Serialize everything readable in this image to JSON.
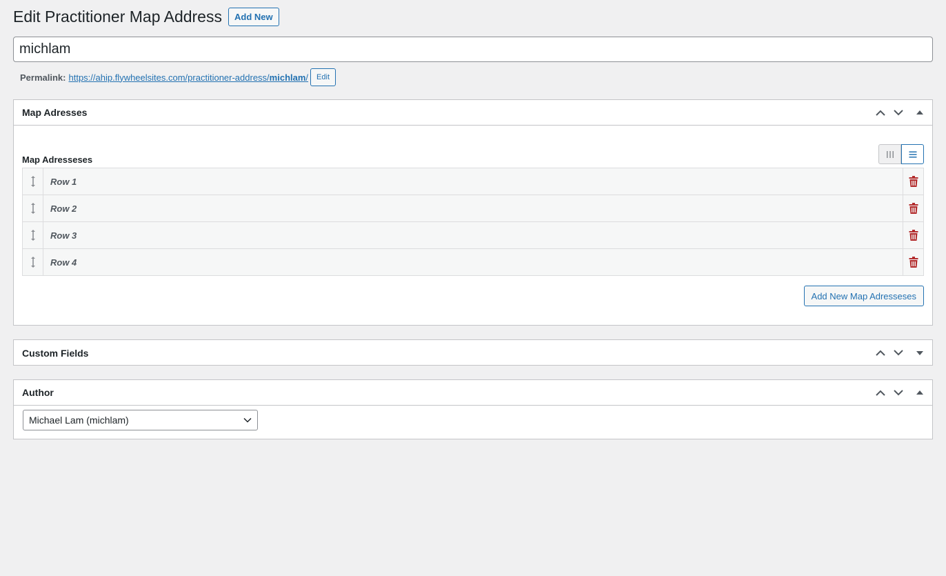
{
  "header": {
    "title": "Edit Practitioner Map Address",
    "add_new_label": "Add New"
  },
  "post_title": {
    "value": "michlam"
  },
  "permalink": {
    "label": "Permalink:",
    "url_base": "https://ahip.flywheelsites.com/practitioner-address/",
    "slug": "michlam",
    "trailing": "/",
    "edit_label": "Edit"
  },
  "map_addresses_box": {
    "title": "Map Adresses",
    "field_label": "Map Adresseses",
    "layout_options": [
      "table-layout-icon",
      "row-layout-icon"
    ],
    "active_layout": "row-layout-icon",
    "rows": [
      {
        "label": "Row 1"
      },
      {
        "label": "Row 2"
      },
      {
        "label": "Row 3"
      },
      {
        "label": "Row 4"
      }
    ],
    "add_button_label": "Add New Map Adresseses"
  },
  "custom_fields_box": {
    "title": "Custom Fields"
  },
  "author_box": {
    "title": "Author",
    "selected": "Michael Lam (michlam)"
  },
  "colors": {
    "accent": "#2271b1",
    "danger": "#b32d2e",
    "background": "#f0f0f1",
    "border": "#c3c4c7"
  }
}
